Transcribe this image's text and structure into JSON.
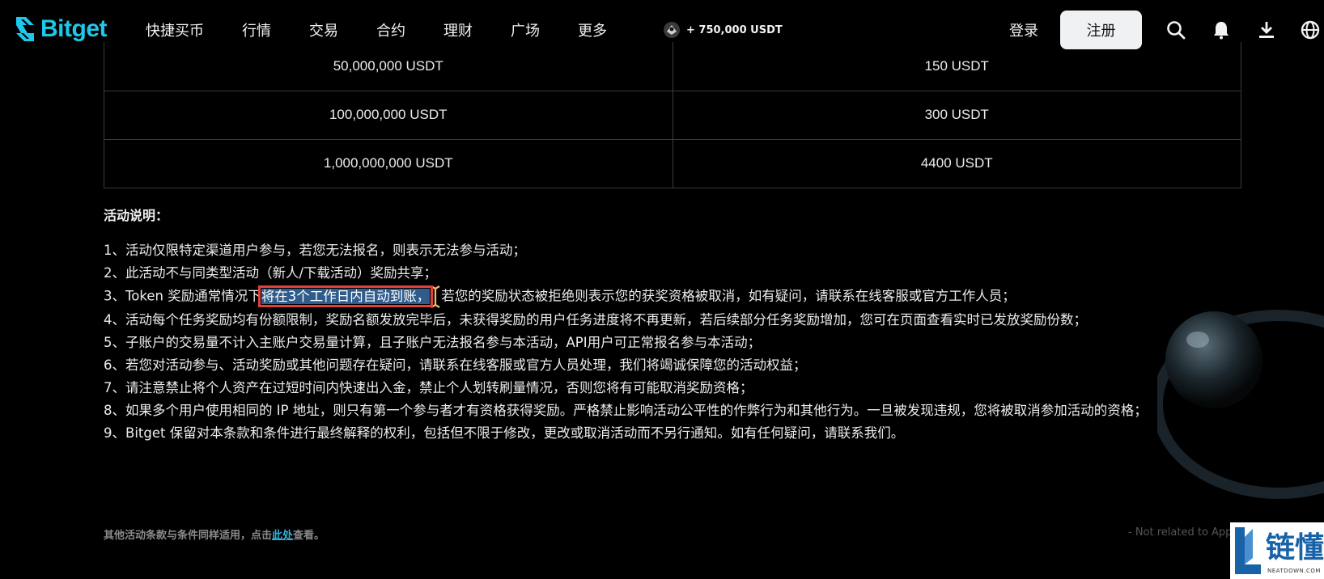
{
  "brand": {
    "name": "Bitget",
    "color": "#1ec8ea"
  },
  "nav": {
    "items": [
      "快捷买币",
      "行情",
      "交易",
      "合约",
      "理财",
      "广场",
      "更多"
    ],
    "promo_text": "+ 750,000 USDT",
    "login_label": "登录",
    "register_label": "注册",
    "icons": [
      "search-icon",
      "bell-icon",
      "download-icon",
      "globe-icon"
    ]
  },
  "reward_table": {
    "rows": [
      {
        "volume": "50,000,000 USDT",
        "reward": "150 USDT"
      },
      {
        "volume": "100,000,000 USDT",
        "reward": "300 USDT"
      },
      {
        "volume": "1,000,000,000 USDT",
        "reward": "4400 USDT"
      }
    ]
  },
  "description": {
    "title": "活动说明：",
    "rules": [
      "1、活动仅限特定渠道用户参与，若您无法报名，则表示无法参与活动；",
      "2、此活动不与同类型活动（新人/下载活动）奖励共享；",
      "4、活动每个任务奖励均有份额限制，奖励名额发放完毕后，未获得奖励的用户任务进度将不再更新，若后续部分任务奖励增加，您可在页面查看实时已发放奖励份数；",
      "5、子账户的交易量不计入主账户交易量计算，且子账户无法报名参与本活动，API用户可正常报名参与本活动；",
      "6、若您对活动参与、活动奖励或其他问题存在疑问，请联系在线客服或官方人员处理，我们将竭诚保障您的活动权益；",
      "7、请注意禁止将个人资产在过短时间内快速出入金，禁止个人划转刷量情况，否则您将有可能取消奖励资格；",
      "8、如果多个用户使用相同的 IP 地址，则只有第一个参与者才有资格获得奖励。严格禁止影响活动公平性的作弊行为和其他行为。一旦被发现违规，您将被取消参加活动的资格；",
      "9、Bitget 保留对本条款和条件进行最终解释的权利，包括但不限于修改，更改或取消活动而不另行通知。如有任何疑问，请联系我们。"
    ],
    "rule3_before": "3、Token 奖励通常情况下",
    "rule3_highlight": "将在3个工作日内自动到账，",
    "rule3_after": "若您的奖励状态被拒绝则表示您的获奖资格被取消，如有疑问，请联系在线客服或官方工作人员；"
  },
  "footer": {
    "note_before": "其他活动条款与条件同样适用，点击",
    "note_link": "此处",
    "note_after": "查看。",
    "disclaimer": "- Not related to Apple"
  },
  "watermark": {
    "text": "链懂",
    "sub": "NEATDOWN.COM"
  }
}
